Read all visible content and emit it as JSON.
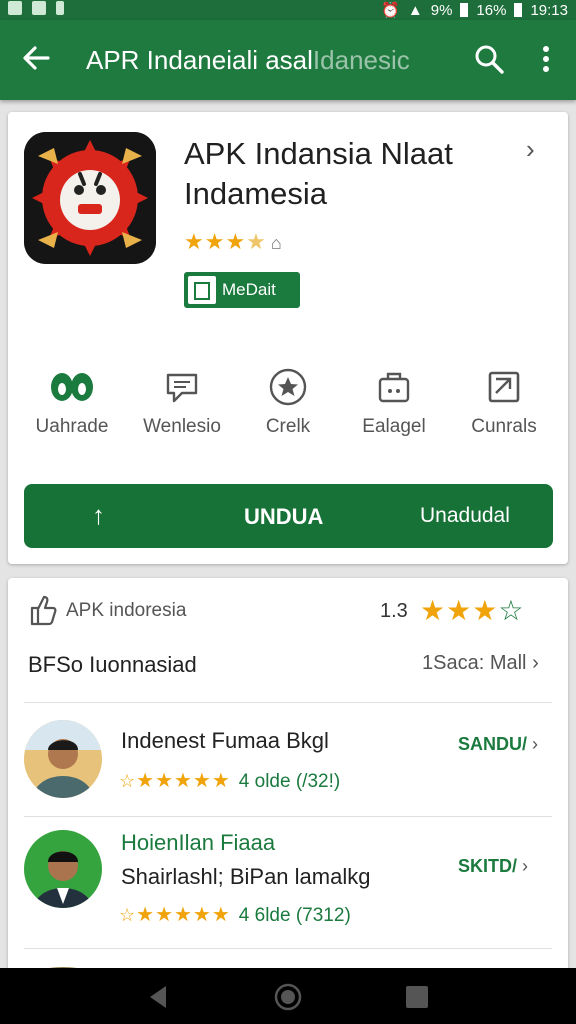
{
  "status": {
    "battery": "9%",
    "signal": "16%",
    "time": "19:13"
  },
  "appbar": {
    "title": "APR Indaneiali asal",
    "title_faded": "Idanesic"
  },
  "app": {
    "name": "APK Indansia Nlaat Indamesia",
    "rating_stars": "★★★",
    "rating_half": "★",
    "badge_label": "MeDait"
  },
  "actions": [
    {
      "label": "Uahrade",
      "icon": "two-drops-icon"
    },
    {
      "label": "Wenlesio",
      "icon": "chat-bubble-icon"
    },
    {
      "label": "Crelk",
      "icon": "star-circle-icon"
    },
    {
      "label": "Ealagel",
      "icon": "bag-icon"
    },
    {
      "label": "Cunrals",
      "icon": "flag-square-icon"
    }
  ],
  "install": {
    "main": "UNDUA",
    "side": "Unadudal"
  },
  "reviews_header": {
    "label": "APK indoresia",
    "score": "1.3",
    "stars": "★★★",
    "outline_star": "☆",
    "subtitle": "BFSo Iuonnasiad",
    "more": "1Saca: Mall"
  },
  "reviews": [
    {
      "name": "Indenest Fumaa Bkgl",
      "name2": "",
      "stars": "★★★★★",
      "outline": "☆",
      "meta": "4 olde (/32!)",
      "action": "SANDU/"
    },
    {
      "name": "HoienIlan Fiaaa",
      "name2": "Shairlashl; BiPan lamalkg",
      "stars": "★★★★★",
      "outline": "☆",
      "meta": "4 6lde (7312)",
      "action": "SKITD/"
    }
  ],
  "colors": {
    "primary": "#1f7a40",
    "accent": "#f0a30a",
    "dark_green": "#177237"
  }
}
